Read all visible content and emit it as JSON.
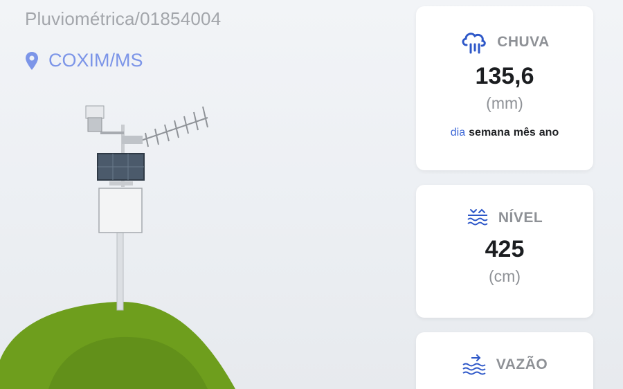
{
  "header": {
    "station_code": "Pluviométrica/01854004",
    "location": "COXIM/MS",
    "location_icon": "location-pin-icon"
  },
  "colors": {
    "accent": "#7c95e8",
    "active_period": "#3b66d6",
    "hill": "#6e9e1d",
    "card_bg": "#ffffff"
  },
  "cards": {
    "chuva": {
      "icon": "rain-cloud-icon",
      "title": "CHUVA",
      "value": "135,6",
      "unit": "(mm)",
      "periods": [
        "dia",
        "semana",
        "mês",
        "ano"
      ],
      "active_period": "dia"
    },
    "nivel": {
      "icon": "water-level-icon",
      "title": "NÍVEL",
      "value": "425",
      "unit": "(cm)"
    },
    "vazao": {
      "icon": "water-flow-icon",
      "title": "VAZÃO"
    }
  }
}
